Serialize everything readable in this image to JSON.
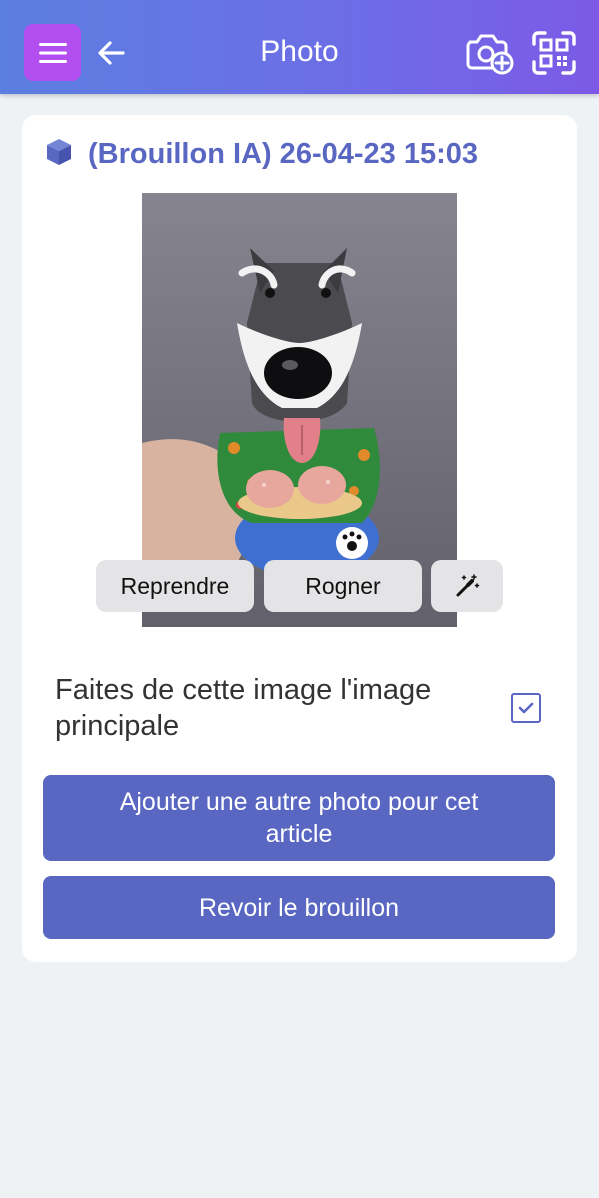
{
  "header": {
    "title": "Photo",
    "menu_icon": "hamburger-menu-icon",
    "back_icon": "arrow-left-icon",
    "camera_icon": "camera-add-icon",
    "scan_icon": "qr-scan-icon",
    "gradient_start": "#5b7fe0",
    "gradient_end": "#7c5ae6",
    "menu_button_color": "#b24df0"
  },
  "draft": {
    "title": "(Brouillon IA) 26-04-23 15:03",
    "icon": "box-icon",
    "color": "#5967c2"
  },
  "image_actions": {
    "retake_label": "Reprendre",
    "crop_label": "Rogner",
    "magic_icon": "magic-wand-icon"
  },
  "main_image": {
    "label": "Faites de cette image l'image principale",
    "checked": true
  },
  "actions": {
    "add_photo_label": "Ajouter une autre photo pour cet article",
    "review_draft_label": "Revoir le brouillon",
    "accent": "#5967c2"
  }
}
